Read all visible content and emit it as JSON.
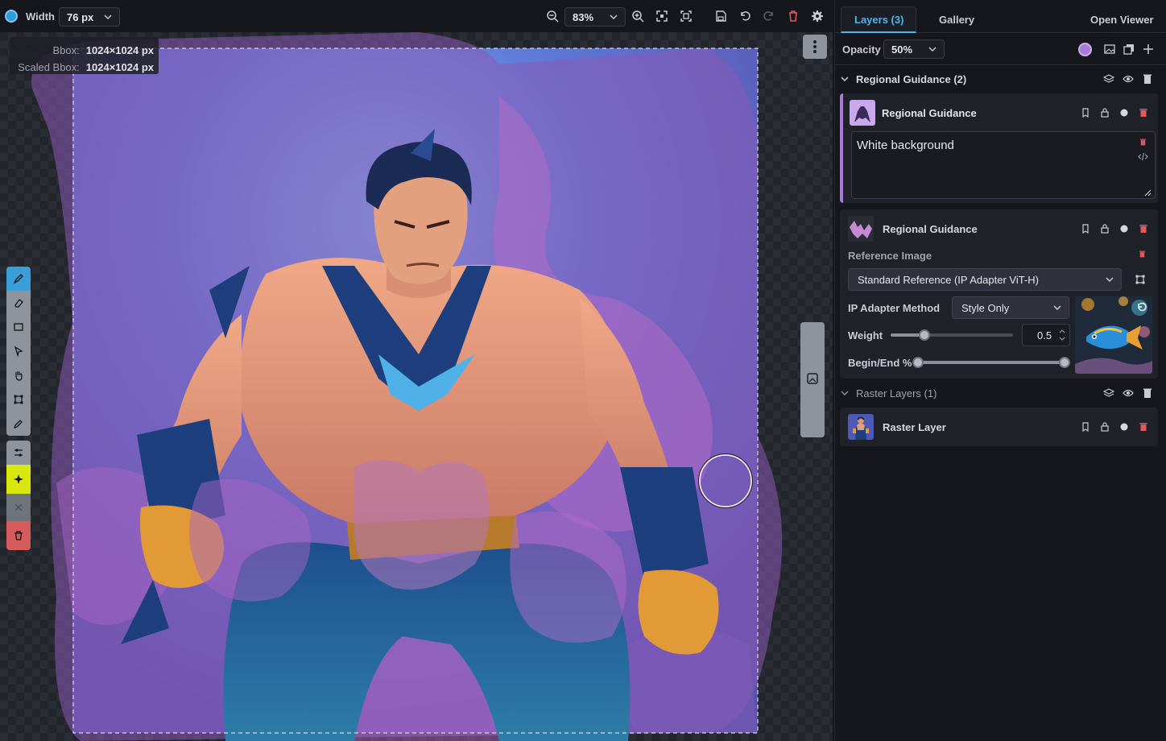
{
  "toolbar": {
    "width_label": "Width",
    "brush_width": "76 px",
    "zoom": "83%"
  },
  "canvas": {
    "bbox_label": "Bbox:",
    "bbox_value": "1024×1024 px",
    "scaled_bbox_label": "Scaled Bbox:",
    "scaled_bbox_value": "1024×1024 px"
  },
  "panel": {
    "tabs": [
      {
        "label": "Layers (3)",
        "active": true
      },
      {
        "label": "Gallery",
        "active": false
      }
    ],
    "open_viewer": "Open Viewer",
    "opacity_label": "Opacity",
    "opacity_value": "50%",
    "regional_group": "Regional Guidance (2)",
    "layer1": {
      "name": "Regional Guidance",
      "prompt": "White background"
    },
    "layer2": {
      "name": "Regional Guidance",
      "reference_label": "Reference Image",
      "model": "Standard Reference (IP Adapter ViT-H)",
      "method_label": "IP Adapter Method",
      "method_value": "Style Only",
      "weight_label": "Weight",
      "weight_value": "0.5",
      "weight": 0.25,
      "begin_end_label": "Begin/End %",
      "begin": 0,
      "end": 1
    },
    "raster_group": "Raster Layers (1)",
    "raster_layer": {
      "name": "Raster Layer"
    }
  },
  "colors": {
    "accent": "#53b4ea",
    "regional_color": "#a77ad8",
    "brush_color": "#2d9bd8",
    "danger": "#e05a5a"
  }
}
